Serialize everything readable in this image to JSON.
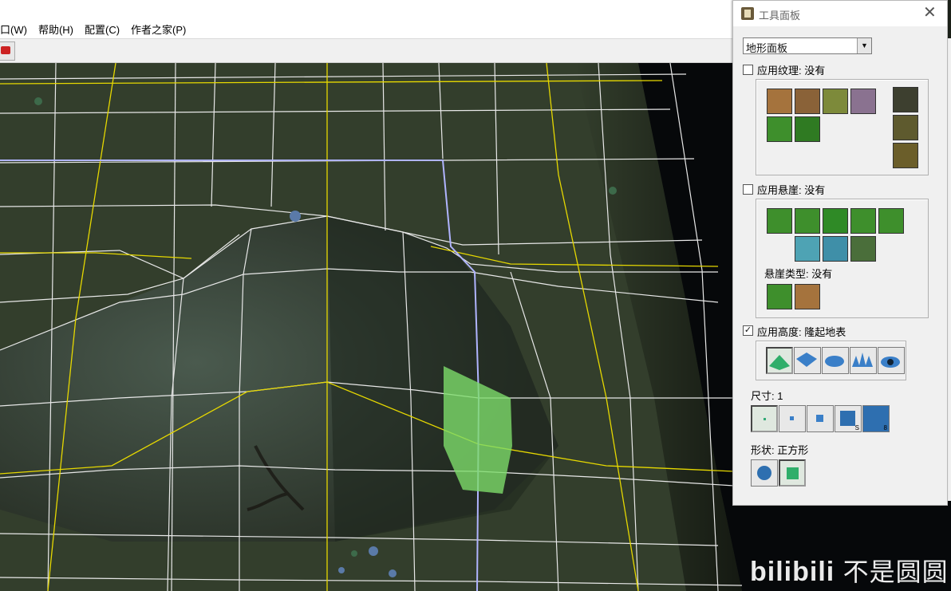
{
  "menu": {
    "items": [
      {
        "label": "口(W)"
      },
      {
        "label": "帮助(H)"
      },
      {
        "label": "配置(C)"
      },
      {
        "label": "作者之家(P)"
      }
    ]
  },
  "panel": {
    "title": "工具面板",
    "close_glyph": "✕",
    "dropdown_value": "地形面板",
    "texture": {
      "label": "应用纹理: 没有",
      "checked": false
    },
    "cliff": {
      "label": "应用悬崖: 没有",
      "checked": false,
      "type_label": "悬崖类型: 没有"
    },
    "height": {
      "label": "应用高度: 隆起地表",
      "checked": true,
      "check_glyph": "✓"
    },
    "size": {
      "label": "尺寸: 1"
    },
    "shape": {
      "label": "形状: 正方形"
    },
    "size_badges": [
      "S",
      "8"
    ]
  },
  "watermark": {
    "brand": "bilibili",
    "text": "不是圆圆"
  },
  "colors": {
    "grid_white": "#e8e8e8",
    "grid_yellow": "#e6d800",
    "selection_green": "#7ddc6a",
    "boundary_blue": "#9aa0ff",
    "terrain_dark": "#2c3526"
  }
}
